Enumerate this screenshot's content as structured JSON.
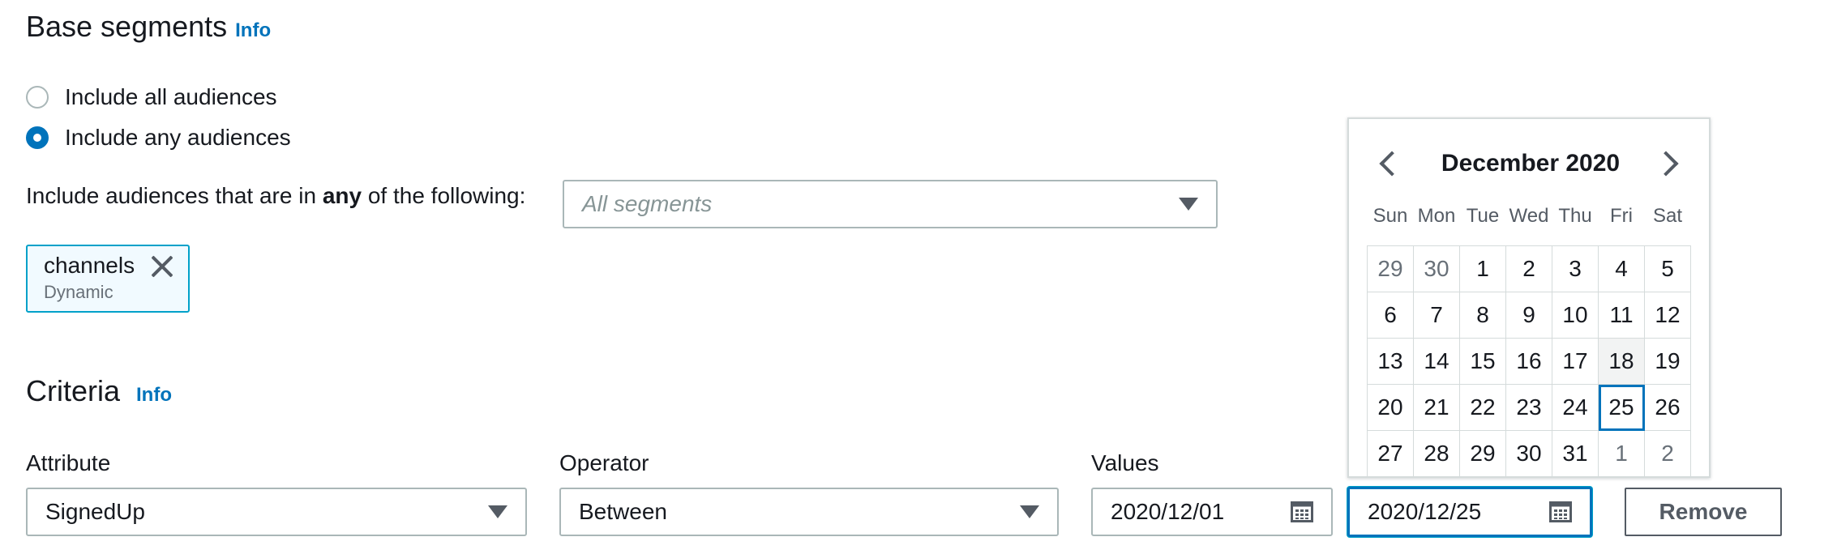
{
  "base_segments": {
    "title": "Base segments",
    "info": "Info",
    "radio_all": "Include all audiences",
    "radio_any": "Include any audiences",
    "include_label_pre": "Include audiences that are in ",
    "include_label_bold": "any",
    "include_label_post": " of the following:",
    "select_placeholder": "All segments",
    "token": {
      "name": "channels",
      "type": "Dynamic"
    }
  },
  "criteria": {
    "title": "Criteria",
    "info": "Info",
    "attribute_label": "Attribute",
    "attribute_value": "SignedUp",
    "operator_label": "Operator",
    "operator_value": "Between",
    "values_label": "Values",
    "value_from": "2020/12/01",
    "value_to": "2020/12/25",
    "remove_label": "Remove"
  },
  "calendar": {
    "month_title": "December 2020",
    "weekdays": [
      "Sun",
      "Mon",
      "Tue",
      "Wed",
      "Thu",
      "Fri",
      "Sat"
    ],
    "weeks": [
      [
        {
          "d": "29",
          "muted": true
        },
        {
          "d": "30",
          "muted": true
        },
        {
          "d": "1"
        },
        {
          "d": "2"
        },
        {
          "d": "3"
        },
        {
          "d": "4"
        },
        {
          "d": "5"
        }
      ],
      [
        {
          "d": "6"
        },
        {
          "d": "7"
        },
        {
          "d": "8"
        },
        {
          "d": "9"
        },
        {
          "d": "10"
        },
        {
          "d": "11"
        },
        {
          "d": "12"
        }
      ],
      [
        {
          "d": "13"
        },
        {
          "d": "14"
        },
        {
          "d": "15"
        },
        {
          "d": "16"
        },
        {
          "d": "17"
        },
        {
          "d": "18",
          "today": true
        },
        {
          "d": "19"
        }
      ],
      [
        {
          "d": "20"
        },
        {
          "d": "21"
        },
        {
          "d": "22"
        },
        {
          "d": "23"
        },
        {
          "d": "24"
        },
        {
          "d": "25",
          "selected": true
        },
        {
          "d": "26"
        }
      ],
      [
        {
          "d": "27"
        },
        {
          "d": "28"
        },
        {
          "d": "29"
        },
        {
          "d": "30"
        },
        {
          "d": "31"
        },
        {
          "d": "1",
          "muted": true
        },
        {
          "d": "2",
          "muted": true
        }
      ]
    ]
  },
  "colors": {
    "accent": "#0073bb",
    "token_border": "#00a1c9",
    "text": "#16191f",
    "muted_text": "#687078",
    "border": "#aab7b8"
  }
}
